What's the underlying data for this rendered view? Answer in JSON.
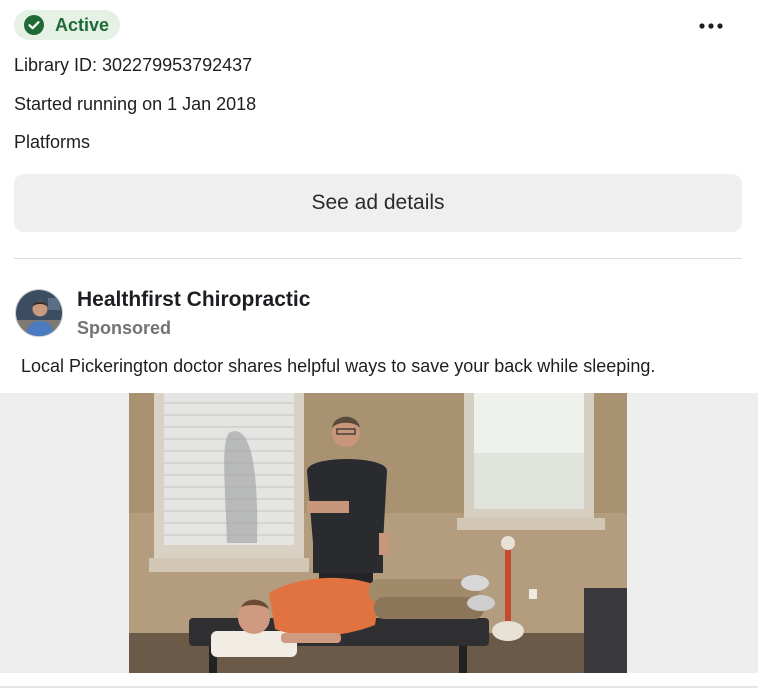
{
  "status": {
    "label": "Active",
    "icon": "check-circle-icon",
    "color": "#1f6a36",
    "bg": "#e6f1e6"
  },
  "menu": {
    "icon": "more-options-icon"
  },
  "library_id": "Library ID: 302279953792437",
  "started_running": "Started running on 1 Jan 2018",
  "platforms_label": "Platforms",
  "details_button": "See ad details",
  "ad": {
    "advertiser": "Healthfirst Chiropractic",
    "sponsored_label": "Sponsored",
    "body_text": "Local Pickerington doctor shares helpful ways to save your back while sleeping.",
    "media": {
      "type": "video-thumbnail"
    }
  }
}
